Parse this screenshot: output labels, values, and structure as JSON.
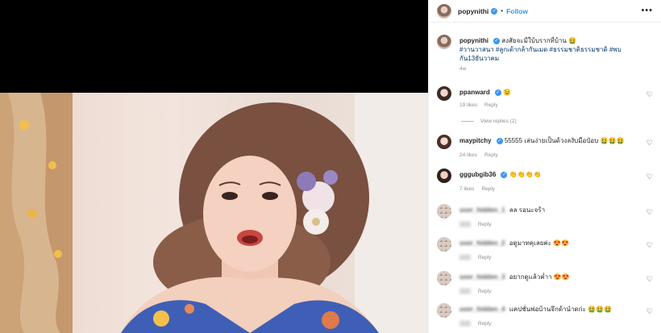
{
  "post": {
    "username": "popynithi",
    "follow_label": "Follow",
    "more_label": "•••"
  },
  "caption": {
    "text": "สงสัยจะมีใบ้บรากที่บ้าน",
    "emoji": "🤮",
    "hashtags": "#วานวาสนา #ลูกเต้ากล้ากันเมด #ธรรมชาติธรรมชาติ #พบกัน13ธันวาคม",
    "time": "4w"
  },
  "comments": [
    {
      "user": "ppanward",
      "text": "",
      "emoji": "😉",
      "likes": "19 likes",
      "reply": "Reply",
      "view_replies": "View replies (2)"
    },
    {
      "user": "maypitchy",
      "text": "55555 เล่นง่ายเป็นด้วงลงับมือป๋อบ",
      "emoji": "🤮🤮🤮",
      "likes": "24 likes",
      "reply": "Reply"
    },
    {
      "user": "gggubgib36",
      "text": "",
      "emoji": "👏👏👏👏",
      "likes": "7 likes",
      "reply": "Reply"
    },
    {
      "user": "user_hidden_1",
      "text": "ลล รอนะจร้า",
      "emoji": "",
      "reply": "Reply"
    },
    {
      "user": "user_hidden_2",
      "text": "อดูมาทคุเลยค่ะ",
      "emoji": "😍😍",
      "reply": "Reply"
    },
    {
      "user": "user_hidden_3",
      "text": "อยากดูแล้วค่ำา",
      "emoji": "😍😍",
      "reply": "Reply"
    },
    {
      "user": "user_hidden_4",
      "text": "แคปชั่นพ่อบ้านจึกด้านำดก่ะ",
      "emoji": "🤮🤮🤮",
      "reply": "Reply"
    }
  ],
  "icons": {
    "heart": "heart-icon",
    "verified": "verified-badge-icon",
    "more": "more-options-icon"
  },
  "colors": {
    "accent": "#3897f0",
    "hashtag": "#003569",
    "meta": "#8e8e8e"
  }
}
